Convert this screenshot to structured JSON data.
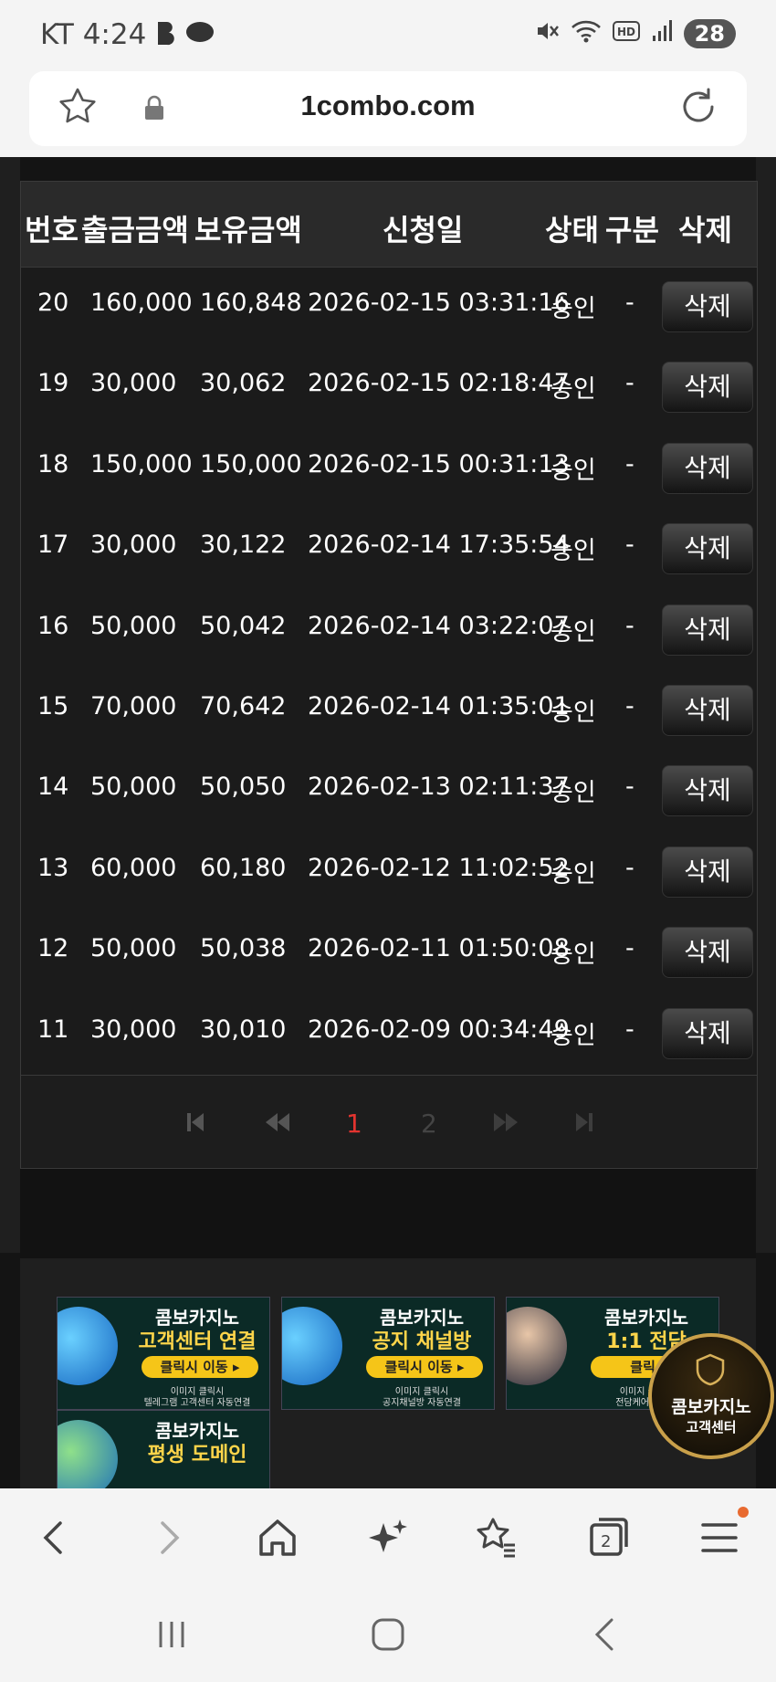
{
  "status_bar": {
    "time": "KT 4:24",
    "battery": "28",
    "icons": [
      "b-app-icon",
      "thread-app-icon",
      "mute-icon",
      "wifi-icon",
      "hd-icon",
      "signal-icon"
    ]
  },
  "browser": {
    "url": "1combo.com"
  },
  "table": {
    "headers": [
      "번호",
      "출금금액",
      "보유금액",
      "신청일",
      "상태",
      "구분",
      "삭제"
    ],
    "rows": [
      {
        "no": "20",
        "amount": "160,000",
        "balance": "160,848",
        "date": "2026-02-15 03:31:16",
        "status": "승인",
        "type": "-",
        "delete": "삭제"
      },
      {
        "no": "19",
        "amount": "30,000",
        "balance": "30,062",
        "date": "2026-02-15 02:18:47",
        "status": "승인",
        "type": "-",
        "delete": "삭제"
      },
      {
        "no": "18",
        "amount": "150,000",
        "balance": "150,000",
        "date": "2026-02-15 00:31:13",
        "status": "승인",
        "type": "-",
        "delete": "삭제"
      },
      {
        "no": "17",
        "amount": "30,000",
        "balance": "30,122",
        "date": "2026-02-14 17:35:54",
        "status": "승인",
        "type": "-",
        "delete": "삭제"
      },
      {
        "no": "16",
        "amount": "50,000",
        "balance": "50,042",
        "date": "2026-02-14 03:22:07",
        "status": "승인",
        "type": "-",
        "delete": "삭제"
      },
      {
        "no": "15",
        "amount": "70,000",
        "balance": "70,642",
        "date": "2026-02-14 01:35:01",
        "status": "승인",
        "type": "-",
        "delete": "삭제"
      },
      {
        "no": "14",
        "amount": "50,000",
        "balance": "50,050",
        "date": "2026-02-13 02:11:37",
        "status": "승인",
        "type": "-",
        "delete": "삭제"
      },
      {
        "no": "13",
        "amount": "60,000",
        "balance": "60,180",
        "date": "2026-02-12 11:02:52",
        "status": "승인",
        "type": "-",
        "delete": "삭제"
      },
      {
        "no": "12",
        "amount": "50,000",
        "balance": "50,038",
        "date": "2026-02-11 01:50:08",
        "status": "승인",
        "type": "-",
        "delete": "삭제"
      },
      {
        "no": "11",
        "amount": "30,000",
        "balance": "30,010",
        "date": "2026-02-09 00:34:49",
        "status": "승인",
        "type": "-",
        "delete": "삭제"
      }
    ]
  },
  "pagination": {
    "pages": [
      "1",
      "2"
    ],
    "current": "1"
  },
  "banners": [
    {
      "title": "콤보카지노",
      "subtitle": "고객센터 연결",
      "button": "클릭시 이동 ▸",
      "note1": "이미지 클릭시",
      "note2": "텔레그램 고객센터 자동연결"
    },
    {
      "title": "콤보카지노",
      "subtitle": "공지 채널방",
      "button": "클릭시 이동 ▸",
      "note1": "이미지 클릭시",
      "note2": "공지채널방 자동연결"
    },
    {
      "title": "콤보카지노",
      "subtitle": "1:1 전담",
      "button": "클릭시",
      "note1": "이미지 클릭시",
      "note2": "전담케어팀 자동"
    },
    {
      "title": "콤보카지노",
      "subtitle": "평생 도메인",
      "button": "",
      "note1": "",
      "note2": ""
    }
  ],
  "cs_badge": {
    "line1": "콤보카지노",
    "line2": "고객센터"
  },
  "colors": {
    "active_page": "#e3342f",
    "accent_gold": "#ffd54a",
    "notification_dot": "#e86a30"
  },
  "tab_count": "2"
}
